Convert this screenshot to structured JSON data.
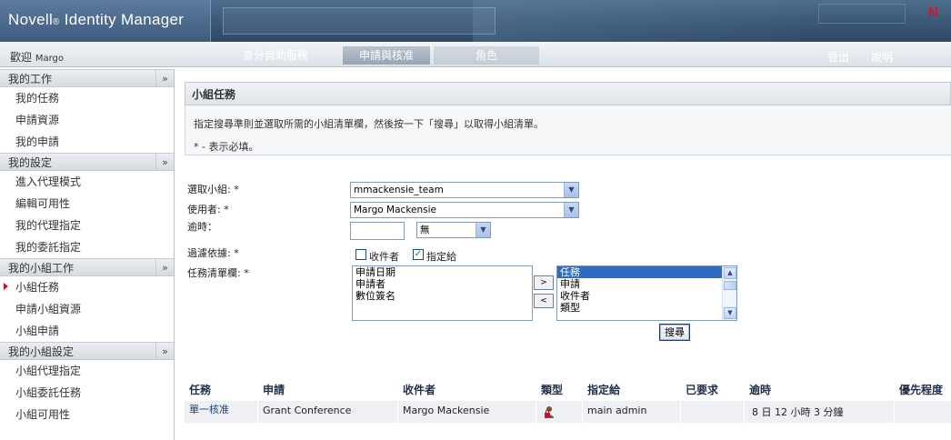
{
  "app": {
    "title_main": "Novell",
    "title_reg": "®",
    "title_rest": " Identity Manager",
    "brand_mark": "N",
    "brand_color": "#d6141c"
  },
  "navbar": {
    "welcome": "歡迎",
    "user": "Margo",
    "tabs": [
      "身分自助服務",
      "申請與核准",
      "角色"
    ],
    "active_tab": "申請與核准",
    "logout": "登出",
    "help": "說明"
  },
  "sidebar": {
    "collapse_icon": "double-chevron-up-icon",
    "groups": [
      {
        "title": "我的工作",
        "items": [
          "我的任務",
          "申請資源",
          "我的申請"
        ]
      },
      {
        "title": "我的設定",
        "items": [
          "進入代理模式",
          "編輯可用性",
          "我的代理指定",
          "我的委託指定"
        ]
      },
      {
        "title": "我的小組工作",
        "items": [
          "小組任務",
          "申請小組資源",
          "小組申請"
        ]
      },
      {
        "title": "我的小組設定",
        "items": [
          "小組代理指定",
          "小組委託任務",
          "小組可用性"
        ]
      }
    ],
    "active_item": "小組任務"
  },
  "main": {
    "section_title": "小組任務",
    "instruction": "指定搜尋準則並選取所需的小組清單欄，然後按一下「搜尋」以取得小組清單。",
    "required_note": "* - 表示必填。",
    "form": {
      "select_team_label": "選取小組: *",
      "select_team_value": "mmackensie_team",
      "user_label": "使用者: *",
      "user_value": "Margo Mackensie",
      "overdue_label": "逾時：",
      "overdue_value": "",
      "overdue_unit": "無",
      "filter_label": "過濾依據: *",
      "filter_recipient": "收件者",
      "filter_recipient_checked": false,
      "filter_assigned": "指定給",
      "filter_assigned_checked": true,
      "columns_label": "任務清單欄: *",
      "available_columns": [
        "申請日期",
        "申請者",
        "數位簽名"
      ],
      "selected_columns": [
        "任務",
        "申請",
        "收件者",
        "類型"
      ],
      "selected_column_highlight": "任務",
      "add_button": ">",
      "remove_button": "<",
      "search_button": "搜尋"
    },
    "table": {
      "headers": [
        "任務",
        "申請",
        "收件者",
        "類型",
        "指定給",
        "已要求",
        "逾時",
        "優先程度"
      ],
      "rows": [
        {
          "task": "單一核准",
          "request": "Grant Conference",
          "recipient": "Margo Mackensie",
          "type_icon": "user-lock-icon",
          "assigned": "main admin",
          "requested": "",
          "overdue": "8 日 12 小時 3 分鐘",
          "priority": ""
        }
      ]
    }
  }
}
